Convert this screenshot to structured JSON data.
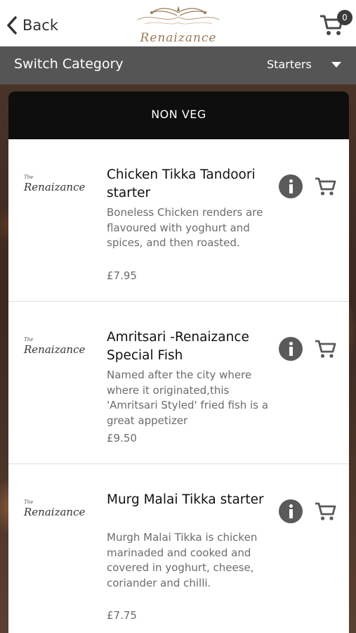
{
  "header": {
    "back_label": "Back",
    "logo_text": "Renaizance",
    "cart_count": "0"
  },
  "category_bar": {
    "label": "Switch Category",
    "selected": "Starters"
  },
  "section": {
    "title": "NON VEG"
  },
  "items": [
    {
      "logo_small": "The",
      "logo_name": "Renaizance",
      "title": "Chicken Tikka Tandoori starter",
      "description": "Boneless Chicken renders are flavoured with yoghurt and spices, and then roasted.",
      "price": "£7.95"
    },
    {
      "logo_small": "The",
      "logo_name": "Renaizance",
      "title": "Amritsari -Renaizance Special Fish",
      "description": "Named after the city where where it originated,this 'Amritsari Styled' fried fish is a great appetizer",
      "price": "£9.50"
    },
    {
      "logo_small": "The",
      "logo_name": "Renaizance",
      "title": "Murg Malai Tikka starter",
      "description": "Murgh Malai Tikka is chicken marinaded and cooked and covered in yoghurt, cheese, coriander and chilli.",
      "price": "£7.75"
    }
  ],
  "colors": {
    "header_bg": "#ffffff",
    "category_bar_bg": "#555555",
    "section_head_bg": "#0e0e0e",
    "icon_gray": "#5a5a5a",
    "logo_gold": "#9a7a55"
  }
}
